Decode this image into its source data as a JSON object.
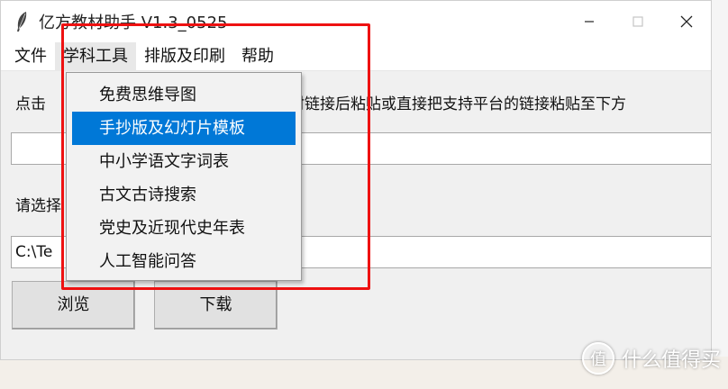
{
  "window": {
    "title": "亿方教材助手 V1.3_0525",
    "controls": [
      "minimize-icon",
      "maximize-icon",
      "close-icon"
    ]
  },
  "menubar": {
    "items": [
      {
        "label": "文件"
      },
      {
        "label": "学科工具",
        "active": true
      },
      {
        "label": "排版及印刷"
      },
      {
        "label": "帮助"
      }
    ]
  },
  "main": {
    "instruction_head": "点击",
    "instruction_tail": "材链接后粘贴或直接把支持平台的链接粘贴至下方",
    "url_input_value": "",
    "save_label": "请选择",
    "path_value": "C:\\Te",
    "browse_label": "浏览",
    "download_label": "下载"
  },
  "dropdown": {
    "items": [
      {
        "label": "免费思维导图"
      },
      {
        "label": "手抄版及幻灯片模板",
        "selected": true
      },
      {
        "label": "中小学语文字词表"
      },
      {
        "label": "古文古诗搜索"
      },
      {
        "label": "党史及近现代史年表"
      },
      {
        "label": "人工智能问答"
      }
    ]
  },
  "watermark": {
    "text": "什么值得买",
    "logo_char": "值"
  },
  "colors": {
    "selection": "#0078d7",
    "highlight_box": "#ee1111",
    "background": "#f0f0f0"
  }
}
